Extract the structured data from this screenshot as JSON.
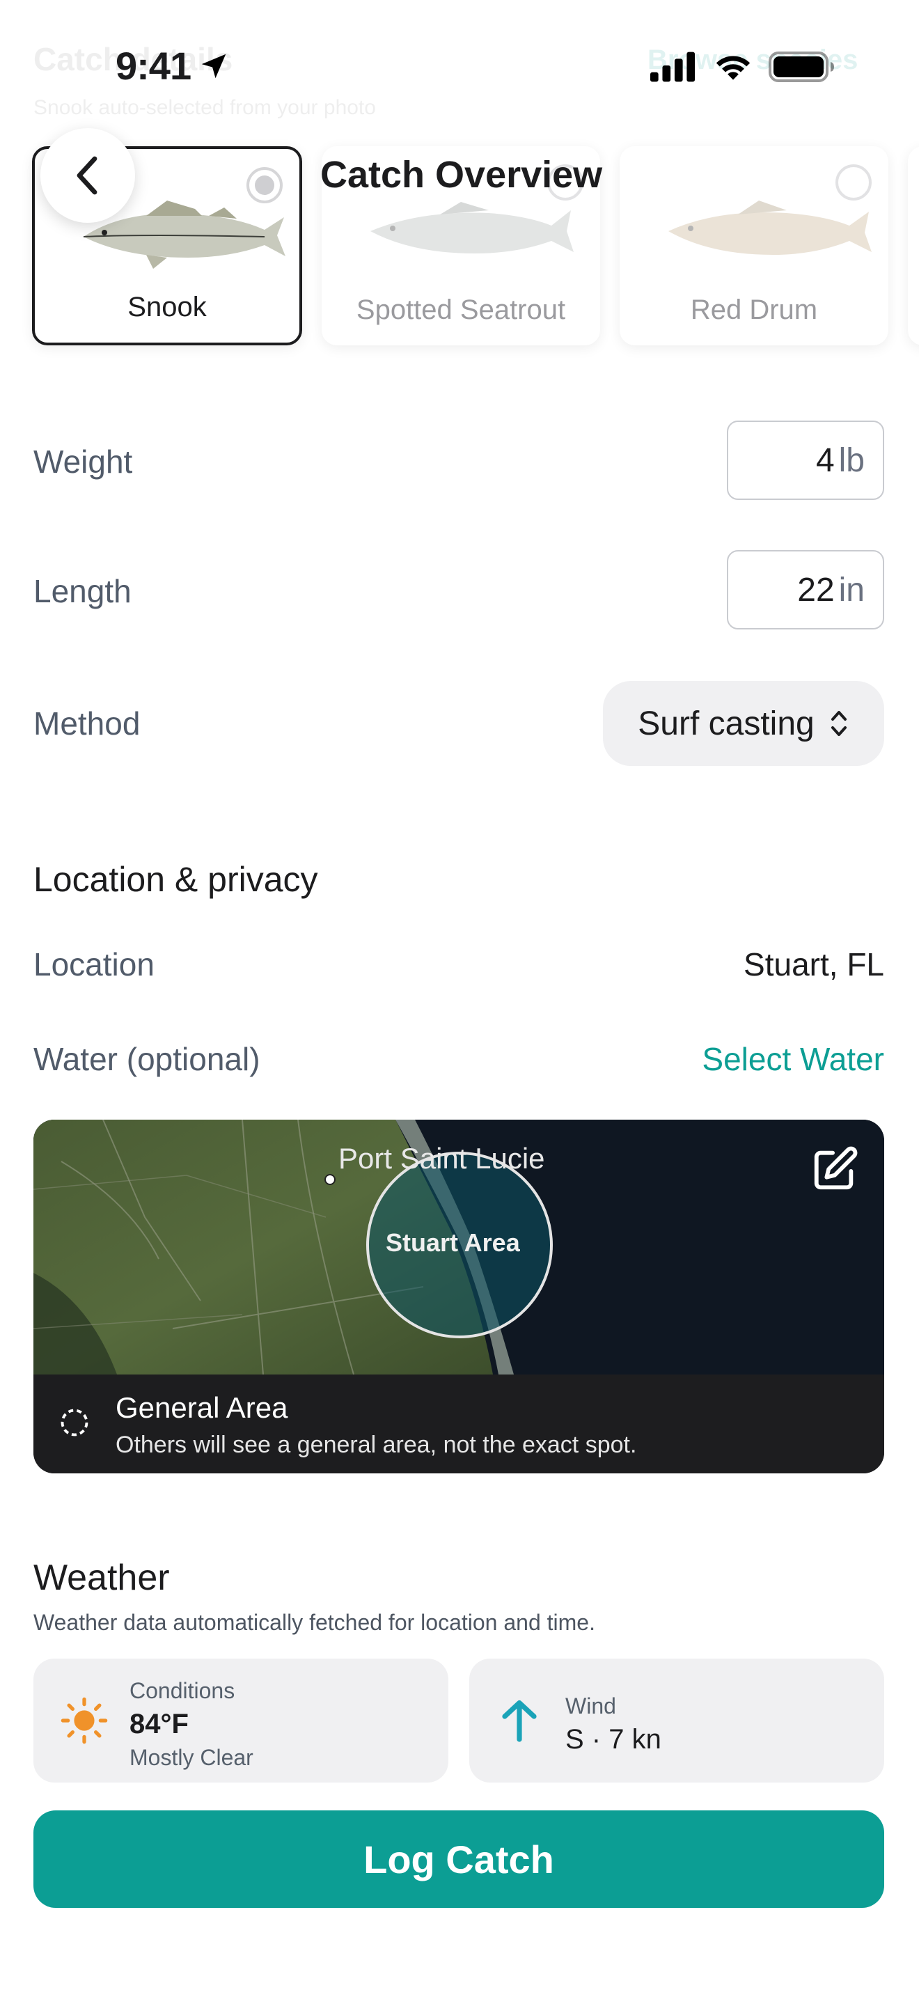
{
  "status_bar": {
    "time": "9:41"
  },
  "background_header": {
    "title": "Catch details",
    "subtitle": "Snook auto-selected from your photo",
    "action": "Browse species"
  },
  "nav": {
    "title": "Catch Overview"
  },
  "species": [
    {
      "name": "Snook",
      "selected": true
    },
    {
      "name": "Spotted Seatrout",
      "selected": false
    },
    {
      "name": "Red Drum",
      "selected": false
    }
  ],
  "form": {
    "weight": {
      "label": "Weight",
      "value": "4",
      "unit": "lb"
    },
    "length": {
      "label": "Length",
      "value": "22",
      "unit": "in"
    },
    "method": {
      "label": "Method",
      "value": "Surf casting"
    }
  },
  "location_privacy": {
    "title": "Location & privacy",
    "location_label": "Location",
    "location_value": "Stuart, FL",
    "water_label": "Water (optional)",
    "water_action": "Select Water",
    "map": {
      "city_label": "Port Saint Lucie",
      "area_label": "Stuart Area",
      "privacy_title": "General Area",
      "privacy_desc": "Others will see a general area, not the exact spot."
    }
  },
  "weather": {
    "title": "Weather",
    "description": "Weather data automatically fetched for location and time.",
    "conditions": {
      "label": "Conditions",
      "value": "84°F",
      "sub": "Mostly Clear"
    },
    "wind": {
      "label": "Wind",
      "value": "S · 7 kn"
    }
  },
  "primary_action": "Log Catch",
  "colors": {
    "accent": "#0c9e94",
    "label_gray": "#515b6a",
    "sun_orange": "#f0922a",
    "wind_teal": "#1aa3b8"
  }
}
